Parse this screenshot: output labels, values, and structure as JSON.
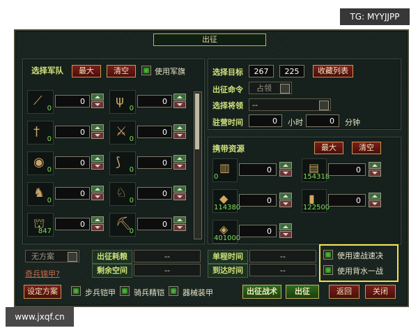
{
  "watermarks": {
    "top_right": "TG: MYYJJPP",
    "bottom_left": "www.jxqf.cn"
  },
  "title": "出征",
  "army": {
    "heading": "选择军队",
    "max_label": "最大",
    "clear_label": "清空",
    "use_flag_label": "使用军旗",
    "units": [
      {
        "icon": "spear-icon",
        "count": "0",
        "value": "0"
      },
      {
        "icon": "trident-icon",
        "count": "0",
        "value": "0"
      },
      {
        "icon": "sword-icon",
        "count": "0",
        "value": "0"
      },
      {
        "icon": "halberd-icon",
        "count": "0",
        "value": "0"
      },
      {
        "icon": "shield-icon",
        "count": "0",
        "value": "0"
      },
      {
        "icon": "bow-icon",
        "count": "0",
        "value": "0"
      },
      {
        "icon": "horse-icon",
        "count": "0",
        "value": "0"
      },
      {
        "icon": "armored-horse-icon",
        "count": "0",
        "value": "0"
      },
      {
        "icon": "siege-icon",
        "count": "847",
        "value": "0"
      },
      {
        "icon": "catapult-icon",
        "count": "0",
        "value": "0"
      }
    ]
  },
  "target": {
    "label": "选择目标",
    "x": "267",
    "y": "225",
    "favorites_label": "收藏列表",
    "order_label": "出征命令",
    "order_value": "占领",
    "general_label": "选择将领",
    "general_value": "--",
    "stay_label": "驻营时间",
    "hours": "0",
    "hours_unit": "小时",
    "minutes": "0",
    "minutes_unit": "分钟"
  },
  "resources": {
    "heading": "携带资源",
    "max_label": "最大",
    "clear_label": "清空",
    "items": [
      {
        "icon": "grain-icon",
        "count": "0",
        "value": "0"
      },
      {
        "icon": "wood-icon",
        "count": "154318",
        "value": "0"
      },
      {
        "icon": "stone-icon",
        "count": "114380",
        "value": "0"
      },
      {
        "icon": "iron-icon",
        "count": "122500",
        "value": "0"
      },
      {
        "icon": "gold-icon",
        "count": "401000",
        "value": "0"
      }
    ]
  },
  "bottom": {
    "no_plan": "无方案",
    "cost_label": "出征耗粮",
    "cost_value": "--",
    "space_label": "剩余空间",
    "space_value": "--",
    "oneway_label": "单程时间",
    "oneway_value": "--",
    "arrive_label": "到达时间",
    "arrive_value": "--",
    "quick_label": "使用速战速决",
    "last_stand_label": "使用背水一战",
    "odd_link": "奇兵锦甲?",
    "set_plan": "设定方案",
    "opt1": "步兵铠甲",
    "opt2": "骑兵精铠",
    "opt3": "器械装甲",
    "tactics": "出征战术",
    "depart": "出征",
    "back": "返回",
    "close": "关闭"
  },
  "colors": {
    "highlight_box": "#f2e24a"
  }
}
